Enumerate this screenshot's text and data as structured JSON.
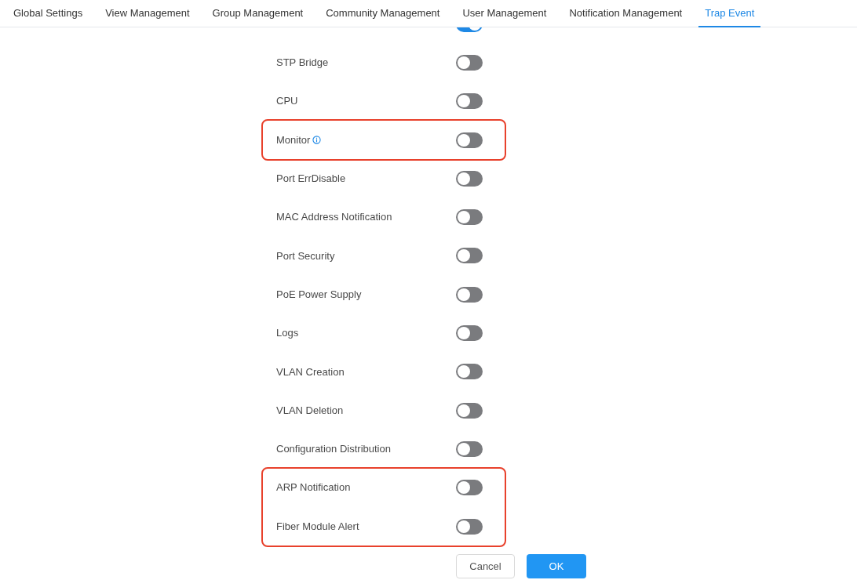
{
  "tabs": [
    {
      "label": "Global Settings",
      "selected": false
    },
    {
      "label": "View Management",
      "selected": false
    },
    {
      "label": "Group Management",
      "selected": false
    },
    {
      "label": "Community Management",
      "selected": false
    },
    {
      "label": "User Management",
      "selected": false
    },
    {
      "label": "Notification Management",
      "selected": false
    },
    {
      "label": "Trap Event",
      "selected": true
    }
  ],
  "groups": [
    {
      "highlighted": false,
      "rows": [
        {
          "on": true
        },
        {
          "label": "STP Bridge",
          "on": false
        },
        {
          "label": "CPU",
          "on": false
        }
      ]
    },
    {
      "highlighted": true,
      "rows": [
        {
          "label": "Monitor",
          "info": true,
          "on": false
        }
      ]
    },
    {
      "highlighted": false,
      "rows": [
        {
          "label": "Port ErrDisable",
          "on": false
        },
        {
          "label": "MAC Address Notification",
          "on": false
        },
        {
          "label": "Port Security",
          "on": false
        },
        {
          "label": "PoE Power Supply",
          "on": false
        },
        {
          "label": "Logs",
          "on": false
        },
        {
          "label": "VLAN Creation",
          "on": false
        },
        {
          "label": "VLAN Deletion",
          "on": false
        },
        {
          "label": "Configuration Distribution",
          "on": false
        }
      ]
    },
    {
      "highlighted": true,
      "rows": [
        {
          "label": "ARP Notification",
          "on": false
        },
        {
          "label": "Fiber Module Alert",
          "on": false
        }
      ]
    }
  ],
  "buttons": [
    {
      "label": "Cancel",
      "kind": "secondary"
    },
    {
      "label": "OK",
      "kind": "primary"
    }
  ]
}
